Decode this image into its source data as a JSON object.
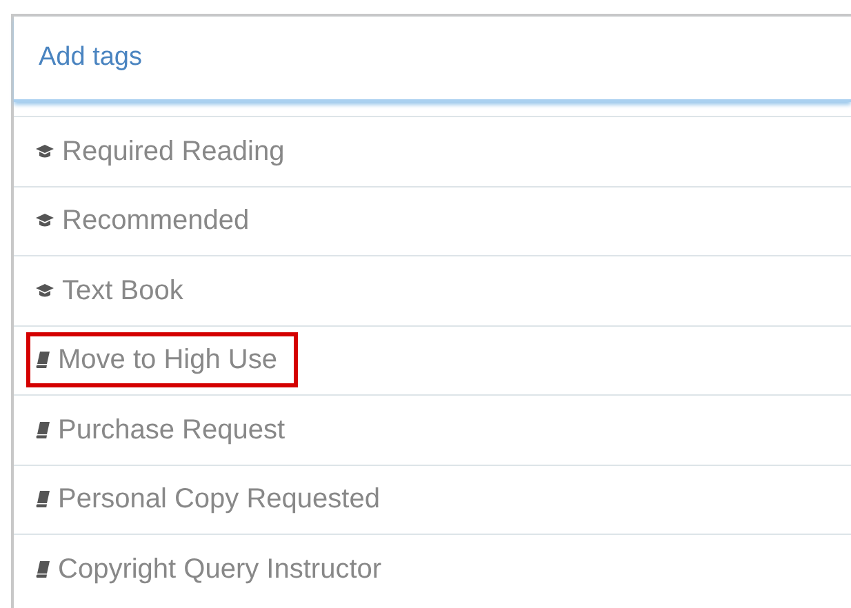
{
  "tag_input": {
    "placeholder": "Add tags"
  },
  "tags": [
    {
      "label": "Required Reading",
      "kind": "cap",
      "highlighted": false
    },
    {
      "label": "Recommended",
      "kind": "cap",
      "highlighted": false
    },
    {
      "label": "Text Book",
      "kind": "cap",
      "highlighted": false
    },
    {
      "label": "Move to High Use",
      "kind": "book",
      "highlighted": true
    },
    {
      "label": "Purchase Request",
      "kind": "book",
      "highlighted": false
    },
    {
      "label": "Personal Copy Requested",
      "kind": "book",
      "highlighted": false
    },
    {
      "label": "Copyright Query Instructor",
      "kind": "book",
      "highlighted": false
    }
  ]
}
